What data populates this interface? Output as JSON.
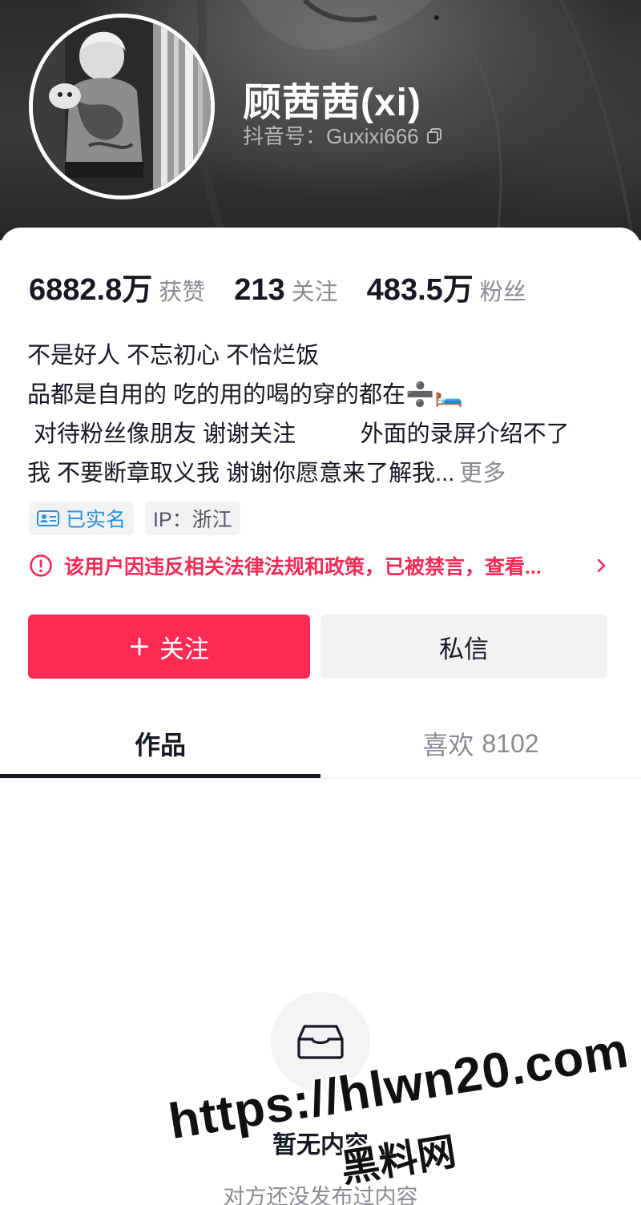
{
  "profile": {
    "nickname": "顾茜茜(xi)",
    "douyin_id": "抖音号：Guxixi666",
    "avatar_icon": "avatar-photo",
    "copy_icon": "copy-icon"
  },
  "stats": [
    {
      "value": "6882.8万",
      "label": "获赞"
    },
    {
      "value": "213",
      "label": "关注"
    },
    {
      "value": "483.5万",
      "label": "粉丝"
    }
  ],
  "bio": {
    "lines": [
      "不是好人 不忘初心 不恰烂饭",
      "品都是自用的 吃的用的喝的穿的都在➗🛏️",
      " 对待粉丝像朋友 谢谢关注          外面的录屏介绍不了",
      "我 不要断章取义我 谢谢你愿意来了解我..."
    ],
    "more": "更多"
  },
  "tags": {
    "verified": "已实名",
    "ip": "IP：浙江"
  },
  "warning": {
    "text": "该用户因违反相关法律法规和政策，已被禁言，查看...",
    "color": "#f02c56"
  },
  "actions": {
    "follow": "关注",
    "message": "私信",
    "follow_color": "#fe2c55"
  },
  "tabs": {
    "works": "作品",
    "likes_label": "喜欢",
    "likes_count": "8102"
  },
  "empty": {
    "title": "暂无内容",
    "subtitle": "对方还没发布过内容",
    "icon": "inbox-icon"
  },
  "watermark": {
    "url": "https://hlwn20.com",
    "text": "黑料网"
  }
}
